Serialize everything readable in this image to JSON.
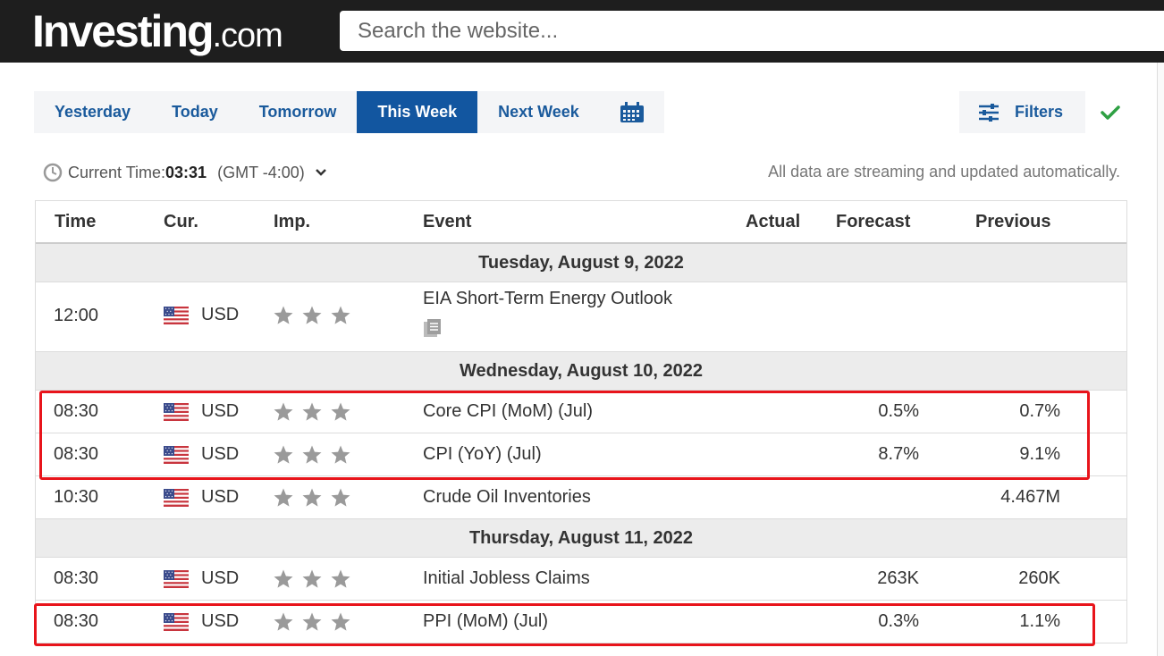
{
  "header": {
    "logo_brand": "Investing",
    "logo_suffix": ".com",
    "search_placeholder": "Search the website..."
  },
  "tabs": [
    {
      "label": "Yesterday",
      "active": false
    },
    {
      "label": "Today",
      "active": false
    },
    {
      "label": "Tomorrow",
      "active": false
    },
    {
      "label": "This Week",
      "active": true
    },
    {
      "label": "Next Week",
      "active": false
    }
  ],
  "filters_label": "Filters",
  "time_bar": {
    "label": "Current Time:",
    "time": "03:31",
    "timezone": "(GMT -4:00)",
    "streaming_note": "All data are streaming and updated automatically."
  },
  "columns": {
    "time": "Time",
    "currency": "Cur.",
    "importance": "Imp.",
    "event": "Event",
    "actual": "Actual",
    "forecast": "Forecast",
    "previous": "Previous"
  },
  "days": [
    {
      "label": "Tuesday, August 9, 2022",
      "events": [
        {
          "time": "12:00",
          "currency": "USD",
          "event": "EIA Short-Term Energy Outlook",
          "actual": "",
          "forecast": "",
          "previous": "",
          "has_doc_icon": true
        }
      ]
    },
    {
      "label": "Wednesday, August 10, 2022",
      "events": [
        {
          "time": "08:30",
          "currency": "USD",
          "event": "Core CPI (MoM) (Jul)",
          "actual": "",
          "forecast": "0.5%",
          "previous": "0.7%"
        },
        {
          "time": "08:30",
          "currency": "USD",
          "event": "CPI (YoY) (Jul)",
          "actual": "",
          "forecast": "8.7%",
          "previous": "9.1%"
        },
        {
          "time": "10:30",
          "currency": "USD",
          "event": "Crude Oil Inventories",
          "actual": "",
          "forecast": "",
          "previous": "4.467M"
        }
      ]
    },
    {
      "label": "Thursday, August 11, 2022",
      "events": [
        {
          "time": "08:30",
          "currency": "USD",
          "event": "Initial Jobless Claims",
          "actual": "",
          "forecast": "263K",
          "previous": "260K"
        },
        {
          "time": "08:30",
          "currency": "USD",
          "event": "PPI (MoM) (Jul)",
          "actual": "",
          "forecast": "0.3%",
          "previous": "1.1%"
        }
      ]
    }
  ],
  "colors": {
    "topbar": "#1e1e1e",
    "tab_active": "#1256a0",
    "link_blue": "#1a5a9c",
    "highlight_red": "#e8141b",
    "check_green": "#2ea043",
    "star_gray": "#9a9a9a"
  },
  "importance_stars": 3
}
